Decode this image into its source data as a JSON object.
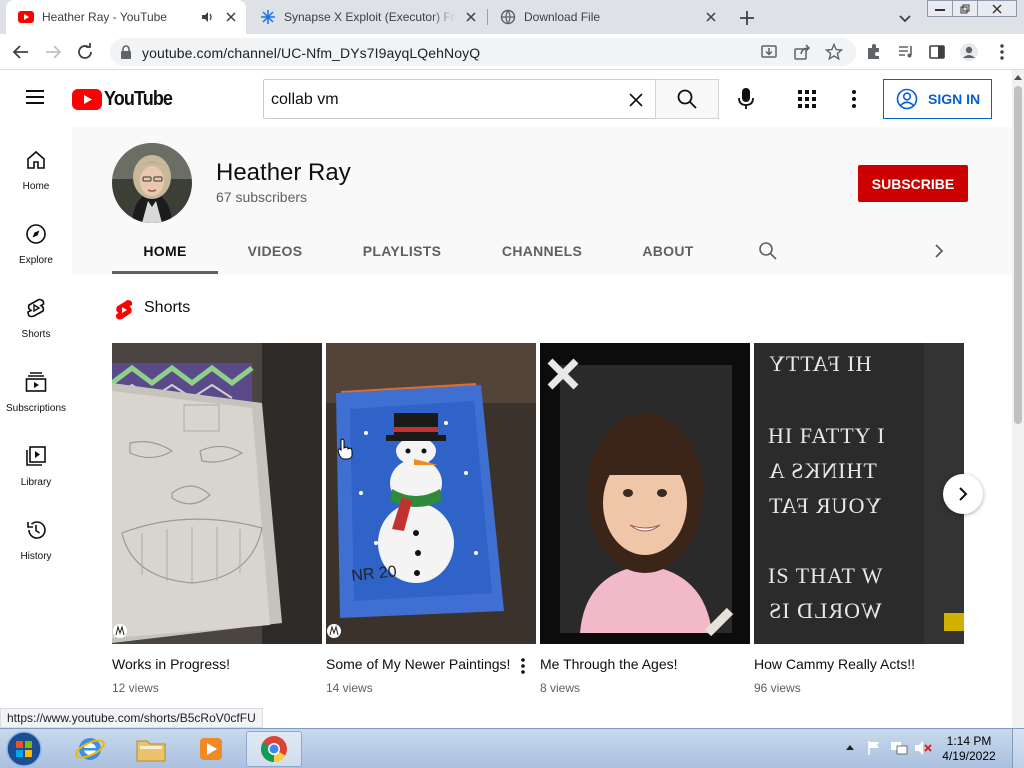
{
  "browser": {
    "tabs": [
      {
        "title": "Heather Ray - YouTube",
        "active": true
      },
      {
        "title": "Synapse X Exploit (Executor) Free"
      },
      {
        "title": "Download File"
      }
    ],
    "url": "youtube.com/channel/UC-Nfm_DYs7I9ayqLQehNoyQ",
    "status_url": "https://www.youtube.com/shorts/B5cRoV0cfFU"
  },
  "youtube": {
    "logo_text": "YouTube",
    "search_value": "collab vm",
    "signin_label": "SIGN IN",
    "guide": [
      {
        "label": "Home",
        "icon": "home-icon"
      },
      {
        "label": "Explore",
        "icon": "compass-icon"
      },
      {
        "label": "Shorts",
        "icon": "shorts-icon"
      },
      {
        "label": "Subscriptions",
        "icon": "subscriptions-icon"
      },
      {
        "label": "Library",
        "icon": "library-icon"
      },
      {
        "label": "History",
        "icon": "history-icon"
      }
    ],
    "channel": {
      "name": "Heather Ray",
      "subscribers": "67 subscribers",
      "subscribe_label": "SUBSCRIBE",
      "tabs": [
        "HOME",
        "VIDEOS",
        "PLAYLISTS",
        "CHANNELS",
        "ABOUT"
      ],
      "selected_tab": "HOME"
    },
    "shelf": {
      "title": "Shorts",
      "items": [
        {
          "title": "Works in Progress!",
          "views": "12 views"
        },
        {
          "title": "Some of My Newer Paintings!",
          "views": "14 views"
        },
        {
          "title": "Me Through the Ages!",
          "views": "8 views"
        },
        {
          "title": "How Cammy Really Acts!!",
          "views": "96 views"
        }
      ],
      "thumb4_lines": [
        "HI FATTY",
        "HI FATTY I",
        "THINKS A",
        "YOUR FAT",
        "IS THAT W",
        "WORLD IS"
      ]
    }
  },
  "taskbar": {
    "time": "1:14 PM",
    "date": "4/19/2022"
  },
  "colors": {
    "youtube_red": "#ff0000",
    "subscribe_red": "#cc0000",
    "link_blue": "#065fd4"
  }
}
